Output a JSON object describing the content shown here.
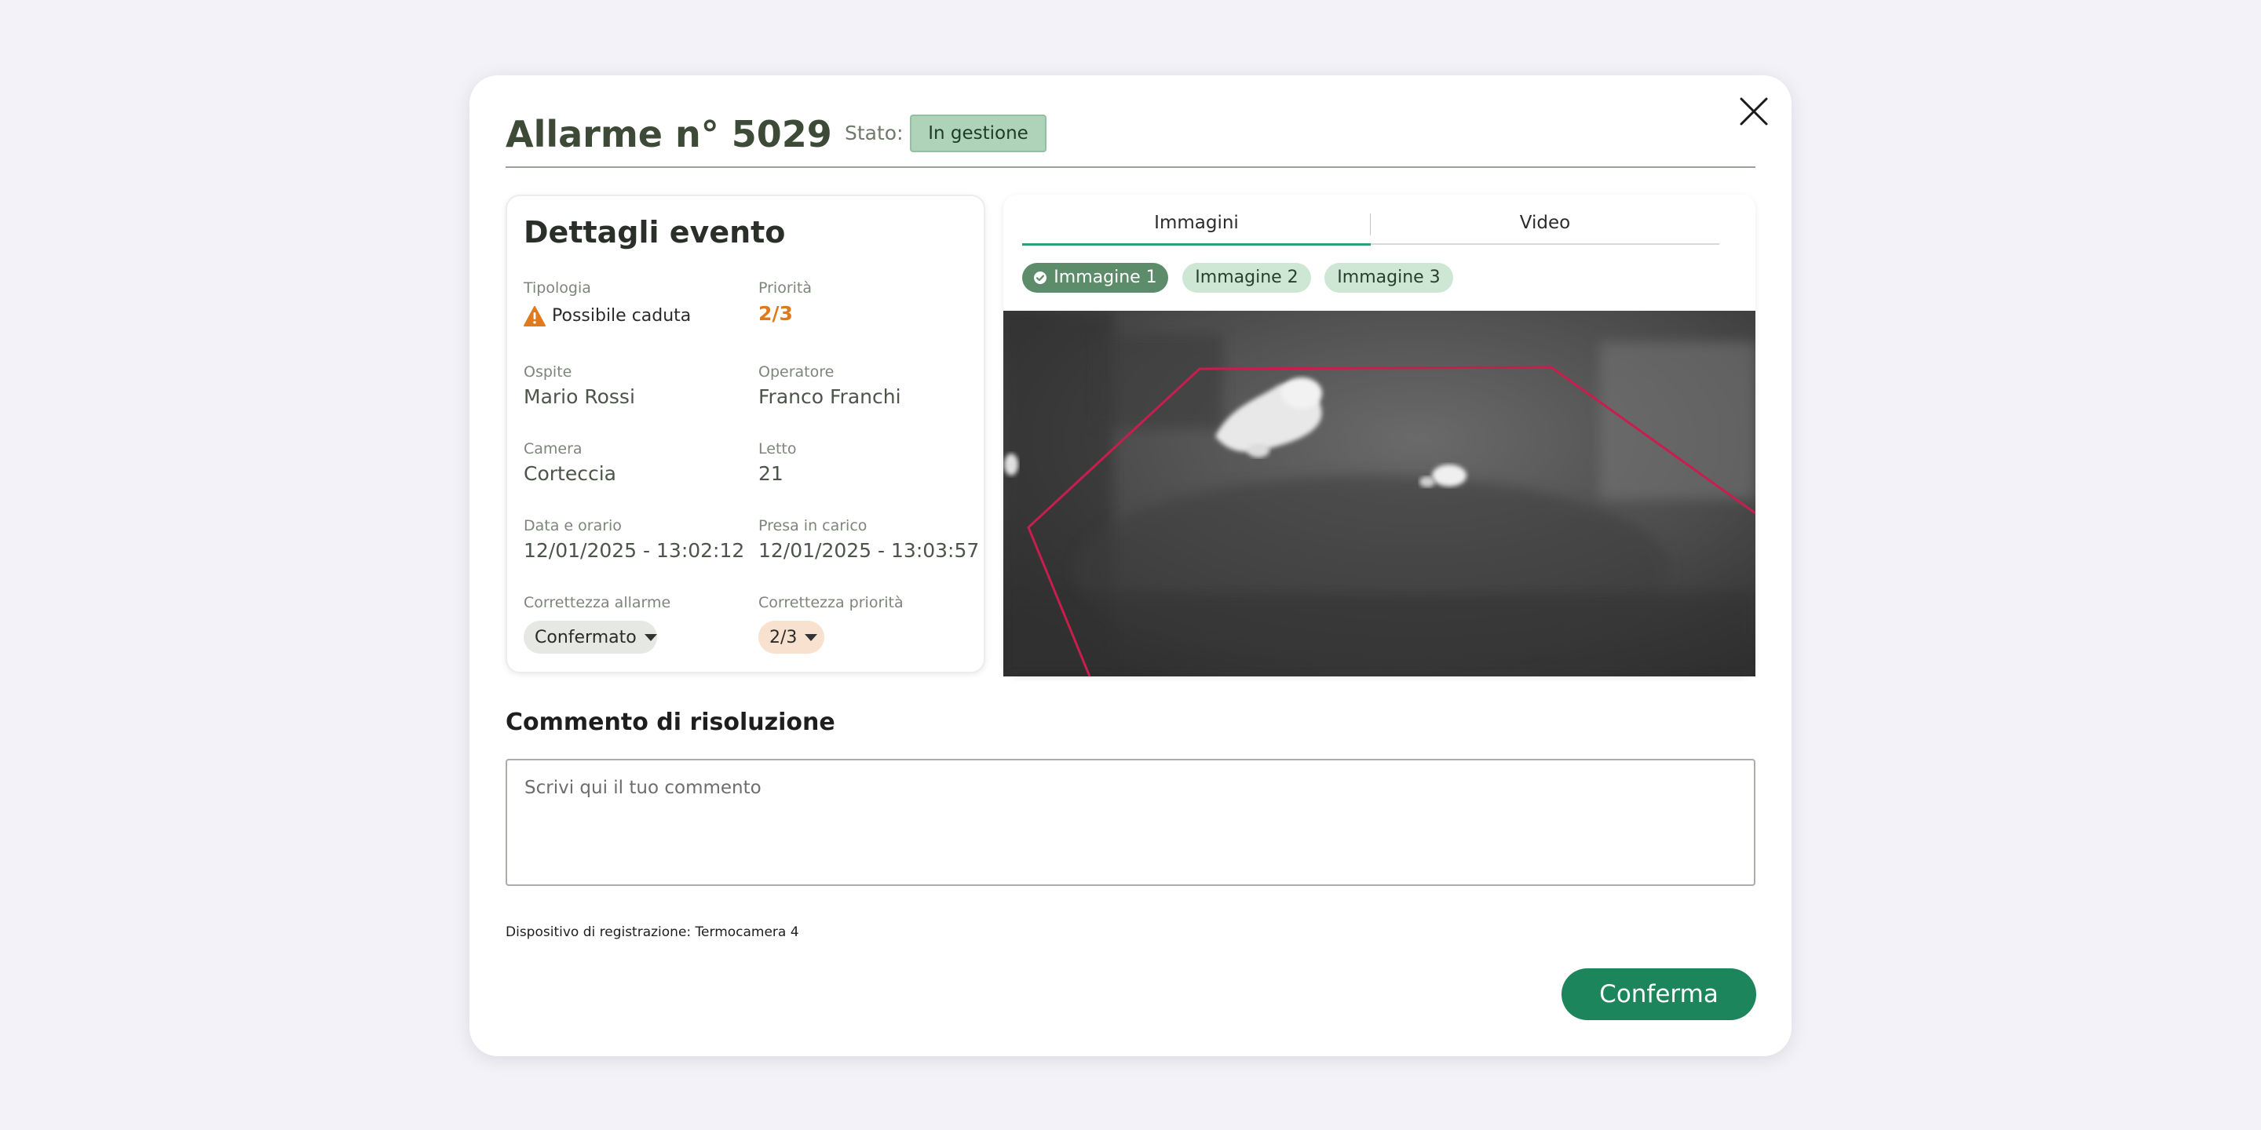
{
  "alarm": {
    "title": "Allarme n° 5029",
    "status_label": "Stato:",
    "status_value": "In gestione"
  },
  "details": {
    "heading": "Dettagli evento",
    "tipologia": {
      "label": "Tipologia",
      "value": "Possibile caduta"
    },
    "priorita": {
      "label": "Priorità",
      "value": "2/3"
    },
    "ospite": {
      "label": "Ospite",
      "value": "Mario Rossi"
    },
    "operatore": {
      "label": "Operatore",
      "value": "Franco Franchi"
    },
    "camera": {
      "label": "Camera",
      "value": "Corteccia"
    },
    "letto": {
      "label": "Letto",
      "value": "21"
    },
    "data_orario": {
      "label": "Data e orario",
      "value": "12/01/2025 - 13:02:12"
    },
    "presa_in_carico": {
      "label": "Presa in carico",
      "value": "12/01/2025 - 13:03:57"
    },
    "correttezza_allarme": {
      "label": "Correttezza allarme",
      "value": "Confermato"
    },
    "correttezza_priorita": {
      "label": "Correttezza priorità",
      "value": "2/3"
    }
  },
  "media": {
    "tabs": [
      {
        "label": "Immagini",
        "active": true
      },
      {
        "label": "Video",
        "active": false
      }
    ],
    "chips": [
      {
        "label": "Immagine 1",
        "selected": true
      },
      {
        "label": "Immagine 2",
        "selected": false
      },
      {
        "label": "Immagine 3",
        "selected": false
      }
    ]
  },
  "comment": {
    "heading": "Commento di risoluzione",
    "placeholder": "Scrivi qui il tuo commento",
    "value": ""
  },
  "device_text": "Dispositivo di registrazione: Termocamera 4",
  "confirm_label": "Conferma",
  "icons": {
    "close": "close-icon",
    "warning": "warning-icon",
    "check": "check-circle-icon",
    "caret": "caret-down-icon"
  },
  "colors": {
    "accent": "#1d855c",
    "status_badge_bg": "#aed3b8",
    "priority": "#de7a1e",
    "warning": "#e07a1f",
    "chip_active": "#5c8c6a",
    "chip_inactive": "#cde7d4",
    "detection_zone": "#d11a4a"
  }
}
